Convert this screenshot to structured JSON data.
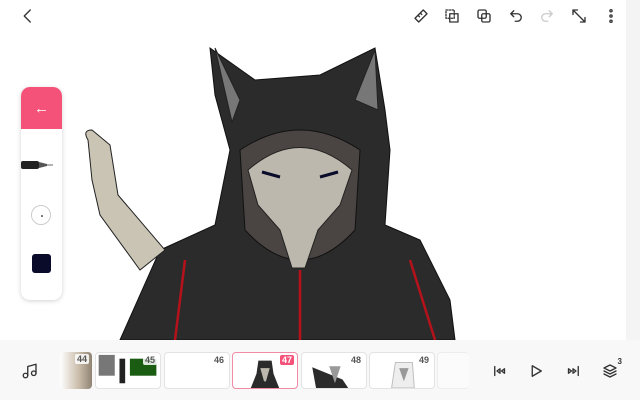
{
  "toolbar": {
    "icons": [
      "back-icon",
      "ruler-icon",
      "lasso-copy-icon",
      "duplicate-icon",
      "undo-icon",
      "redo-icon",
      "resize-icon",
      "more-icon"
    ]
  },
  "tools": {
    "back_icon": "←",
    "brush_size": 1,
    "color": "#0a0a2a"
  },
  "timeline": {
    "frames": [
      {
        "num": "44"
      },
      {
        "num": "45"
      },
      {
        "num": "46"
      },
      {
        "num": "47",
        "selected": true
      },
      {
        "num": "48"
      },
      {
        "num": "49"
      }
    ],
    "layers_count": "3"
  },
  "colors": {
    "accent": "#f5527a"
  }
}
